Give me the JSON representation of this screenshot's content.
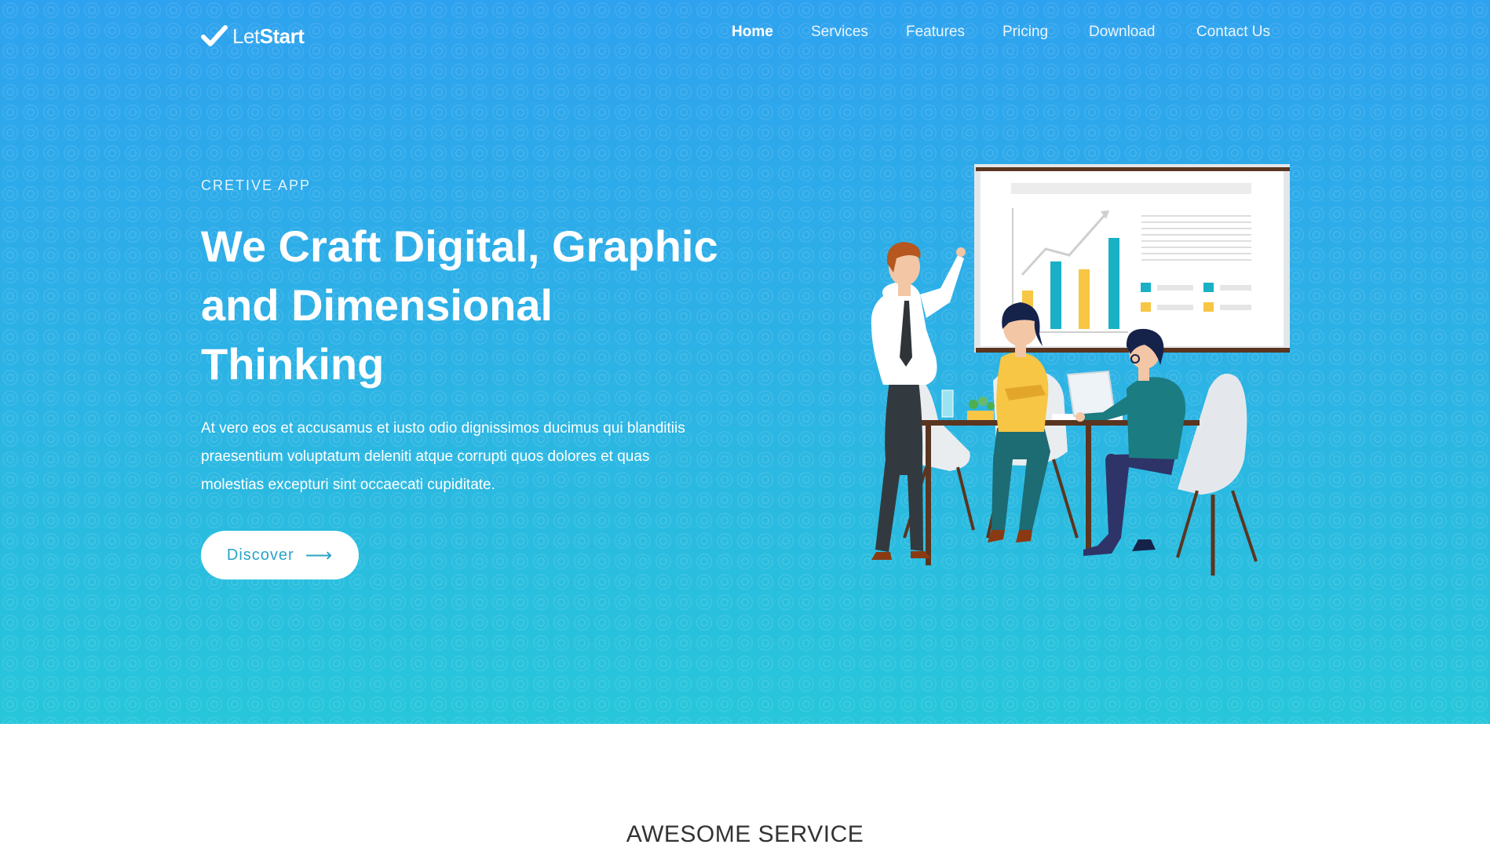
{
  "brand": {
    "name_light": "Let",
    "name_bold": "Start",
    "icon": "checkmark-icon"
  },
  "nav": {
    "items": [
      {
        "label": "Home",
        "active": true
      },
      {
        "label": "Services",
        "active": false
      },
      {
        "label": "Features",
        "active": false
      },
      {
        "label": "Pricing",
        "active": false
      },
      {
        "label": "Download",
        "active": false
      },
      {
        "label": "Contact Us",
        "active": false
      }
    ]
  },
  "hero": {
    "eyebrow": "CRETIVE APP",
    "headline": [
      "We Craft Digital, Graphic",
      "and Dimensional",
      "Thinking"
    ],
    "description": [
      "At vero eos et accusamus et iusto odio dignissimos ducimus qui blanditiis",
      "praesentium voluptatum deleniti atque corrupti quos dolores et quas",
      "molestias excepturi sint occaecati cupiditate."
    ],
    "cta_label": "Discover",
    "cta_icon": "arrow-right-icon"
  },
  "services": {
    "title": "AWESOME SERVICE"
  },
  "colors": {
    "hero_top": "#2ea2ef",
    "hero_bottom": "#27c6da",
    "accent_teal": "#1ab0c6",
    "accent_yellow": "#f6c644"
  }
}
